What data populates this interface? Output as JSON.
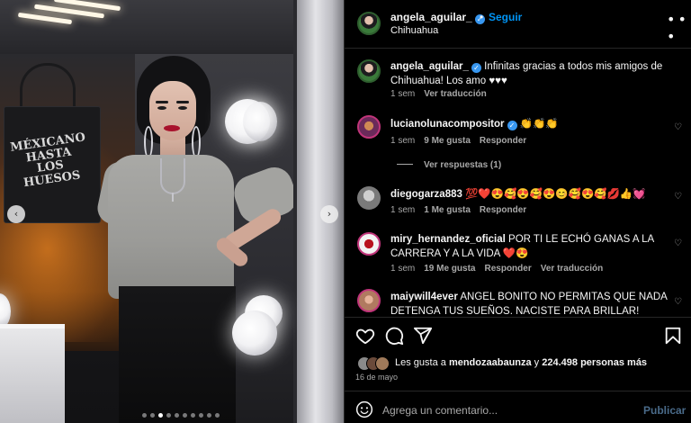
{
  "post": {
    "carousel": {
      "prev_glyph": "‹",
      "next_glyph": "›",
      "dots_total": 10,
      "active_dot": 2,
      "tote_text": "MÉXICANO HASTA LOS HUESOS"
    },
    "header": {
      "username": "angela_aguilar_",
      "verified_glyph": "✓",
      "separator": "•",
      "follow_label": "Seguir",
      "location": "Chihuahua",
      "more_glyph": "• • •"
    },
    "caption": {
      "username": "angela_aguilar_",
      "text": " Infinitas gracias a todos mis amigos de Chihuahua! Los amo ♥♥♥",
      "time": "1 sem",
      "translate_label": "Ver traducción"
    },
    "comments": [
      {
        "username": "lucianolunacompositor",
        "verified": true,
        "text": " 👏👏👏",
        "time": "1 sem",
        "likes": "9 Me gusta",
        "reply_label": "Responder",
        "replies_label": "Ver respuestas (1)"
      },
      {
        "username": "diegogarza883",
        "text": " 💯❤️😍🥰😍🥰😍😊🥰😍🥰💋👍💓",
        "time": "1 sem",
        "likes": "1 Me gusta",
        "reply_label": "Responder"
      },
      {
        "username": "miry_hernandez_oficial",
        "text": " POR TI LE ECHÓ GANAS A LA CARRERA Y A LA VIDA ❤️😍",
        "time": "1 sem",
        "likes": "19 Me gusta",
        "reply_label": "Responder",
        "translate_label": "Ver traducción"
      },
      {
        "username": "maiywill4ever",
        "text": " ANGEL BONITO NO PERMITAS QUE NADA DETENGA TUS SUEÑOS. NACISTE PARA BRILLAR!"
      }
    ],
    "likes_summary": {
      "prefix": "Les gusta a ",
      "user": "mendozaabaunza",
      "middle": " y ",
      "count": "224.498 personas más"
    },
    "date": "16 de mayo",
    "comment_box": {
      "placeholder": "Agrega un comentario...",
      "publish_label": "Publicar"
    },
    "heart_glyph": "♡",
    "colors": {
      "follow": "#0095f6",
      "verified": "#3897f0",
      "publish_disabled": "#4a6b8a",
      "background": "#000000"
    },
    "icons": [
      "heart-icon",
      "comment-icon",
      "share-icon",
      "bookmark-icon",
      "emoji-icon",
      "more-icon"
    ]
  }
}
